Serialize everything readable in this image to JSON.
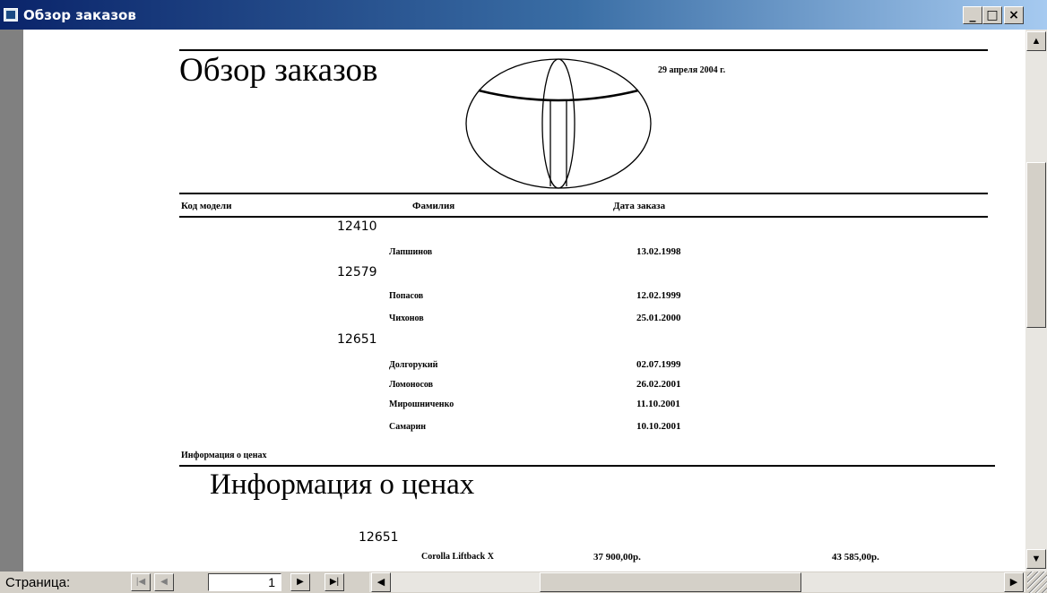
{
  "window": {
    "title": "Обзор заказов",
    "minimize": "_",
    "maximize": "□",
    "close": "×"
  },
  "report": {
    "title": "Обзор заказов",
    "date": "29 апреля 2004 г.",
    "columns": [
      "Код модели",
      "Фамилия",
      "Дата заказа"
    ],
    "groups": [
      {
        "code": "12410",
        "rows": [
          {
            "name": "Лапшинов",
            "date": "13.02.1998"
          }
        ]
      },
      {
        "code": "12579",
        "rows": [
          {
            "name": "Попасов",
            "date": "12.02.1999"
          },
          {
            "name": "Чихонов",
            "date": "25.01.2000"
          }
        ]
      },
      {
        "code": "12651",
        "rows": [
          {
            "name": "Долгорукий",
            "date": "02.07.1999"
          },
          {
            "name": "Ломоносов",
            "date": "26.02.2001"
          },
          {
            "name": "Мирошниченко",
            "date": "11.10.2001"
          },
          {
            "name": "Самарин",
            "date": "10.10.2001"
          }
        ]
      }
    ],
    "price_section": {
      "subreport_label": "Информация о ценах",
      "heading": "Информация о ценах",
      "group_code": "12651",
      "model": "Corolla Liftback X",
      "price_1": "37 900,00р.",
      "price_2": "43 585,00р."
    }
  },
  "navigation": {
    "page_label": "Страница:",
    "current_page": "1",
    "first": "|◀",
    "prev": "◀",
    "next": "▶",
    "last": "▶|"
  },
  "scrollbars": {
    "up": "▲",
    "down": "▼",
    "left": "◀",
    "right": "▶"
  }
}
